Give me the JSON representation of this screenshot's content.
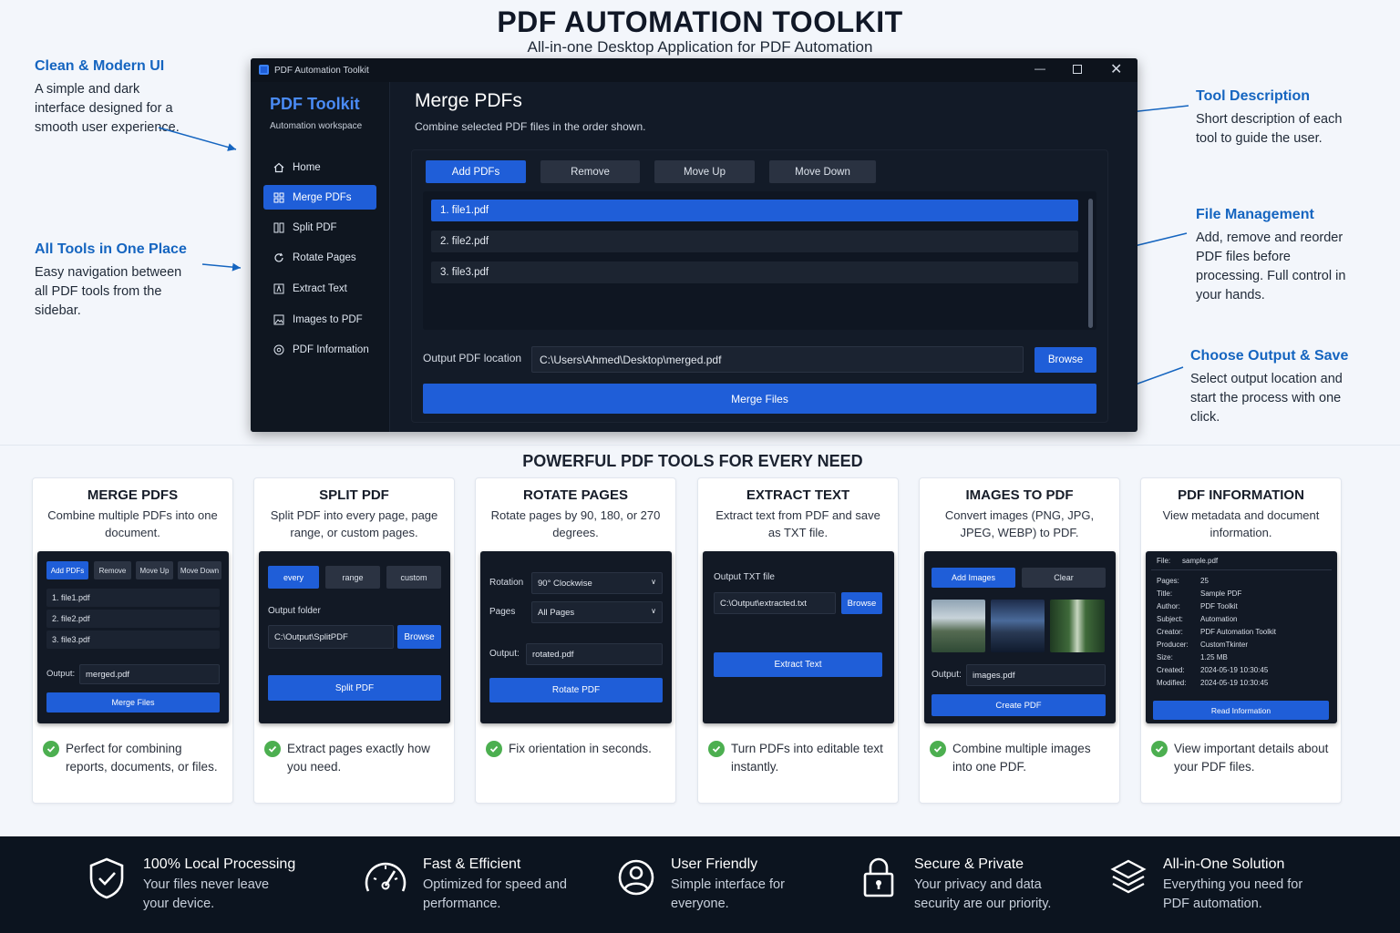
{
  "header": {
    "title": "PDF AUTOMATION TOOLKIT",
    "subtitle": "All-in-one Desktop Application for PDF Automation"
  },
  "annotations": {
    "clean_ui": {
      "title": "Clean & Modern UI",
      "text": "A simple and dark interface designed for a smooth user experience."
    },
    "all_tools": {
      "title": "All Tools in One Place",
      "text": "Easy navigation between all PDF tools from the sidebar."
    },
    "tool_desc": {
      "title": "Tool Description",
      "text": "Short description of each tool to guide the user."
    },
    "file_mgmt": {
      "title": "File Management",
      "text": "Add, remove and reorder PDF files before processing. Full control in your hands."
    },
    "output": {
      "title": "Choose Output & Save",
      "text": "Select output location and start the process with one click."
    }
  },
  "window": {
    "title": "PDF Automation Toolkit",
    "sidebar": {
      "brand": "PDF Toolkit",
      "tagline": "Automation workspace",
      "items": [
        {
          "label": "Home",
          "icon": "home-icon"
        },
        {
          "label": "Merge PDFs",
          "icon": "merge-icon"
        },
        {
          "label": "Split PDF",
          "icon": "split-icon"
        },
        {
          "label": "Rotate Pages",
          "icon": "rotate-icon"
        },
        {
          "label": "Extract Text",
          "icon": "text-icon"
        },
        {
          "label": "Images to PDF",
          "icon": "image-icon"
        },
        {
          "label": "PDF Information",
          "icon": "info-icon"
        }
      ],
      "active": "Merge PDFs"
    },
    "main": {
      "title": "Merge PDFs",
      "description": "Combine selected PDF files in the order shown.",
      "buttons": {
        "add": "Add PDFs",
        "remove": "Remove",
        "move_up": "Move Up",
        "move_down": "Move Down"
      },
      "files": [
        "1.  file1.pdf",
        "2.  file2.pdf",
        "3.  file3.pdf"
      ],
      "output_label": "Output PDF location",
      "output_value": "C:\\Users\\Ahmed\\Desktop\\merged.pdf",
      "browse": "Browse",
      "action": "Merge Files"
    }
  },
  "tools_section": {
    "title": "POWERFUL PDF TOOLS FOR EVERY NEED",
    "cards": {
      "merge": {
        "title": "MERGE PDFS",
        "desc": "Combine multiple PDFs into one document.",
        "btns": [
          "Add PDFs",
          "Remove",
          "Move Up",
          "Move Down"
        ],
        "files": [
          "1.  file1.pdf",
          "2.  file2.pdf",
          "3.  file3.pdf"
        ],
        "output_label": "Output:",
        "output_value": "merged.pdf",
        "action": "Merge Files",
        "benefit": "Perfect for combining reports, documents, or files."
      },
      "split": {
        "title": "SPLIT PDF",
        "desc": "Split PDF into every page, page range, or custom pages.",
        "modes": [
          "every",
          "range",
          "custom"
        ],
        "folder_label": "Output folder",
        "folder_value": "C:\\Output\\SplitPDF",
        "browse": "Browse",
        "action": "Split PDF",
        "benefit": "Extract pages exactly how you need."
      },
      "rotate": {
        "title": "ROTATE PAGES",
        "desc": "Rotate pages by 90, 180, or 270 degrees.",
        "rotation_label": "Rotation",
        "rotation_value": "90° Clockwise",
        "pages_label": "Pages",
        "pages_value": "All Pages",
        "output_label": "Output:",
        "output_value": "rotated.pdf",
        "action": "Rotate PDF",
        "benefit": "Fix orientation in seconds."
      },
      "extract": {
        "title": "EXTRACT TEXT",
        "desc": "Extract text from PDF and save as TXT file.",
        "file_label": "Output TXT file",
        "file_value": "C:\\Output\\extracted.txt",
        "browse": "Browse",
        "action": "Extract Text",
        "benefit": "Turn PDFs into editable text instantly."
      },
      "images": {
        "title": "IMAGES TO PDF",
        "desc": "Convert images (PNG, JPG, JPEG, WEBP) to PDF.",
        "add": "Add Images",
        "clear": "Clear",
        "output_label": "Output:",
        "output_value": "images.pdf",
        "action": "Create PDF",
        "benefit": "Combine multiple images into one PDF."
      },
      "info": {
        "title": "PDF INFORMATION",
        "desc": "View metadata and document information.",
        "file_label": "File:",
        "file_value": "sample.pdf",
        "rows": [
          {
            "k": "Pages:",
            "v": "25"
          },
          {
            "k": "Title:",
            "v": "Sample PDF"
          },
          {
            "k": "Author:",
            "v": "PDF Toolkit"
          },
          {
            "k": "Subject:",
            "v": "Automation"
          },
          {
            "k": "Creator:",
            "v": "PDF Automation Toolkit"
          },
          {
            "k": "Producer:",
            "v": "CustomTkinter"
          },
          {
            "k": "Size:",
            "v": "1.25 MB"
          },
          {
            "k": "Created:",
            "v": "2024-05-19 10:30:45"
          },
          {
            "k": "Modified:",
            "v": "2024-05-19 10:30:45"
          }
        ],
        "action": "Read Information",
        "benefit": "View important details about your PDF files."
      }
    }
  },
  "features": [
    {
      "title": "100% Local Processing",
      "desc": "Your files never leave your device.",
      "icon": "shield-check-icon"
    },
    {
      "title": "Fast & Efficient",
      "desc": "Optimized for speed and performance.",
      "icon": "speedometer-icon"
    },
    {
      "title": "User Friendly",
      "desc": "Simple interface for everyone.",
      "icon": "user-icon"
    },
    {
      "title": "Secure & Private",
      "desc": "Your privacy and data security are our priority.",
      "icon": "lock-icon"
    },
    {
      "title": "All-in-One Solution",
      "desc": "Everything you need for PDF automation.",
      "icon": "layers-icon"
    }
  ],
  "colors": {
    "accent": "#1f5ed8",
    "annotation": "#1565c0",
    "window_bg": "#121a27",
    "check": "#4caf50"
  }
}
